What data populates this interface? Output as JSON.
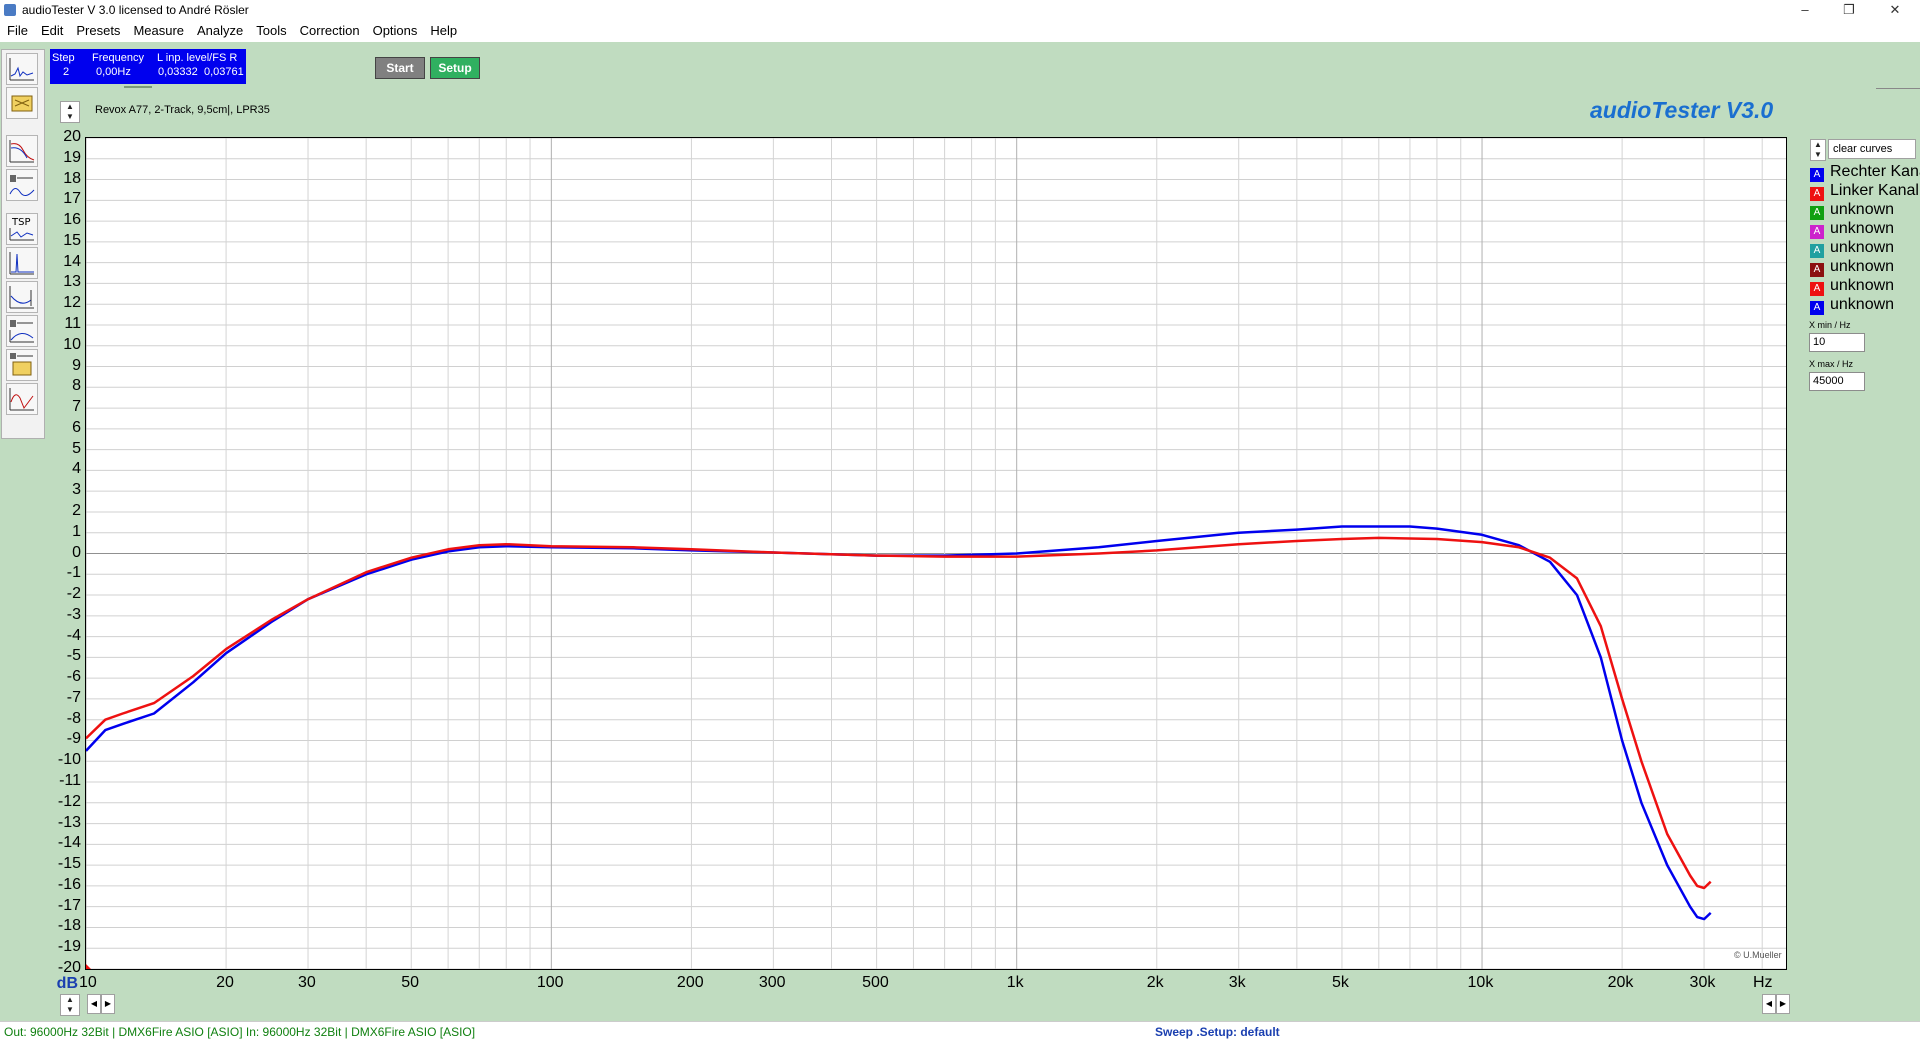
{
  "window": {
    "title": "audioTester  V 3.0   licensed to André Rösler"
  },
  "menu": [
    "File",
    "Edit",
    "Presets",
    "Measure",
    "Analyze",
    "Tools",
    "Correction",
    "Options",
    "Help"
  ],
  "status_box": {
    "headers": [
      "Step",
      "Frequency",
      "L  inp. level/FS  R"
    ],
    "values": [
      "2",
      "0,00Hz",
      "0,03332",
      "0,03761"
    ]
  },
  "buttons": {
    "start": "Start",
    "setup": "Setup"
  },
  "caption": "Revox A77, 2-Track, 9,5cm|, LPR35",
  "brand": "audioTester  V3.0",
  "clear_curves": "clear curves",
  "legend": [
    {
      "label": "Rechter Kanal",
      "color": "#0000ee"
    },
    {
      "label": "Linker Kanal",
      "color": "#ee1111"
    },
    {
      "label": "unknown",
      "color": "#10a010"
    },
    {
      "label": "unknown",
      "color": "#cc22cc"
    },
    {
      "label": "unknown",
      "color": "#20a0a0"
    },
    {
      "label": "unknown",
      "color": "#8b1010"
    },
    {
      "label": "unknown",
      "color": "#ee1111"
    },
    {
      "label": "unknown",
      "color": "#0000ee"
    }
  ],
  "xmin": {
    "label": "X min / Hz",
    "value": "10"
  },
  "xmax": {
    "label": "X max / Hz",
    "value": "45000"
  },
  "copyright": "© U.Mueller",
  "statusbar": {
    "left": "Out: 96000Hz 32Bit  | DMX6Fire ASIO [ASIO]   In: 96000Hz 32Bit  | DMX6Fire ASIO [ASIO]",
    "center": "Sweep .Setup: default"
  },
  "chart_data": {
    "type": "line",
    "ylabel": "dB",
    "xlabel": "Hz",
    "xscale": "log",
    "xlim": [
      10,
      45000
    ],
    "ylim": [
      -20,
      20
    ],
    "grid": true,
    "y_ticks": [
      20,
      19,
      18,
      17,
      16,
      15,
      14,
      13,
      12,
      11,
      10,
      9,
      8,
      7,
      6,
      5,
      4,
      3,
      2,
      1,
      0,
      -1,
      -2,
      -3,
      -4,
      -5,
      -6,
      -7,
      -8,
      -9,
      -10,
      -11,
      -12,
      -13,
      -14,
      -15,
      -16,
      -17,
      -18,
      -19,
      -20
    ],
    "x_ticks": [
      {
        "v": 10,
        "t": "10"
      },
      {
        "v": 20,
        "t": "20"
      },
      {
        "v": 30,
        "t": "30"
      },
      {
        "v": 50,
        "t": "50"
      },
      {
        "v": 100,
        "t": "100"
      },
      {
        "v": 200,
        "t": "200"
      },
      {
        "v": 300,
        "t": "300"
      },
      {
        "v": 500,
        "t": "500"
      },
      {
        "v": 1000,
        "t": "1k"
      },
      {
        "v": 2000,
        "t": "2k"
      },
      {
        "v": 3000,
        "t": "3k"
      },
      {
        "v": 5000,
        "t": "5k"
      },
      {
        "v": 10000,
        "t": "10k"
      },
      {
        "v": 20000,
        "t": "20k"
      },
      {
        "v": 30000,
        "t": "30k"
      }
    ],
    "series": [
      {
        "name": "Rechter Kanal",
        "color": "#0000ee",
        "points": [
          [
            10,
            -9.5
          ],
          [
            11,
            -8.5
          ],
          [
            12,
            -8.2
          ],
          [
            14,
            -7.7
          ],
          [
            17,
            -6.2
          ],
          [
            20,
            -4.8
          ],
          [
            25,
            -3.3
          ],
          [
            30,
            -2.2
          ],
          [
            40,
            -1.0
          ],
          [
            50,
            -0.3
          ],
          [
            60,
            0.1
          ],
          [
            70,
            0.3
          ],
          [
            80,
            0.35
          ],
          [
            100,
            0.3
          ],
          [
            150,
            0.25
          ],
          [
            200,
            0.15
          ],
          [
            300,
            0.05
          ],
          [
            500,
            -0.1
          ],
          [
            700,
            -0.1
          ],
          [
            1000,
            0.0
          ],
          [
            1500,
            0.3
          ],
          [
            2000,
            0.6
          ],
          [
            3000,
            1.0
          ],
          [
            4000,
            1.15
          ],
          [
            5000,
            1.3
          ],
          [
            6000,
            1.3
          ],
          [
            7000,
            1.3
          ],
          [
            8000,
            1.2
          ],
          [
            10000,
            0.9
          ],
          [
            12000,
            0.4
          ],
          [
            14000,
            -0.4
          ],
          [
            16000,
            -2.0
          ],
          [
            18000,
            -5.0
          ],
          [
            20000,
            -9.0
          ],
          [
            22000,
            -12.0
          ],
          [
            25000,
            -15.0
          ],
          [
            28000,
            -17.0
          ],
          [
            29000,
            -17.5
          ],
          [
            30000,
            -17.6
          ],
          [
            31000,
            -17.3
          ]
        ]
      },
      {
        "name": "Linker Kanal",
        "color": "#ee1111",
        "points": [
          [
            10,
            -8.9
          ],
          [
            11,
            -8.0
          ],
          [
            12,
            -7.7
          ],
          [
            14,
            -7.2
          ],
          [
            17,
            -5.9
          ],
          [
            20,
            -4.6
          ],
          [
            25,
            -3.2
          ],
          [
            30,
            -2.2
          ],
          [
            40,
            -0.9
          ],
          [
            50,
            -0.2
          ],
          [
            60,
            0.2
          ],
          [
            70,
            0.4
          ],
          [
            80,
            0.45
          ],
          [
            100,
            0.35
          ],
          [
            150,
            0.3
          ],
          [
            200,
            0.2
          ],
          [
            300,
            0.05
          ],
          [
            500,
            -0.1
          ],
          [
            700,
            -0.15
          ],
          [
            1000,
            -0.15
          ],
          [
            1500,
            0.0
          ],
          [
            2000,
            0.15
          ],
          [
            3000,
            0.45
          ],
          [
            4000,
            0.6
          ],
          [
            5000,
            0.7
          ],
          [
            6000,
            0.75
          ],
          [
            8000,
            0.7
          ],
          [
            10000,
            0.55
          ],
          [
            12000,
            0.3
          ],
          [
            14000,
            -0.2
          ],
          [
            16000,
            -1.2
          ],
          [
            18000,
            -3.5
          ],
          [
            20000,
            -7.0
          ],
          [
            22000,
            -10.0
          ],
          [
            25000,
            -13.5
          ],
          [
            28000,
            -15.5
          ],
          [
            29000,
            -16.0
          ],
          [
            30000,
            -16.1
          ],
          [
            31000,
            -15.8
          ]
        ]
      }
    ]
  }
}
